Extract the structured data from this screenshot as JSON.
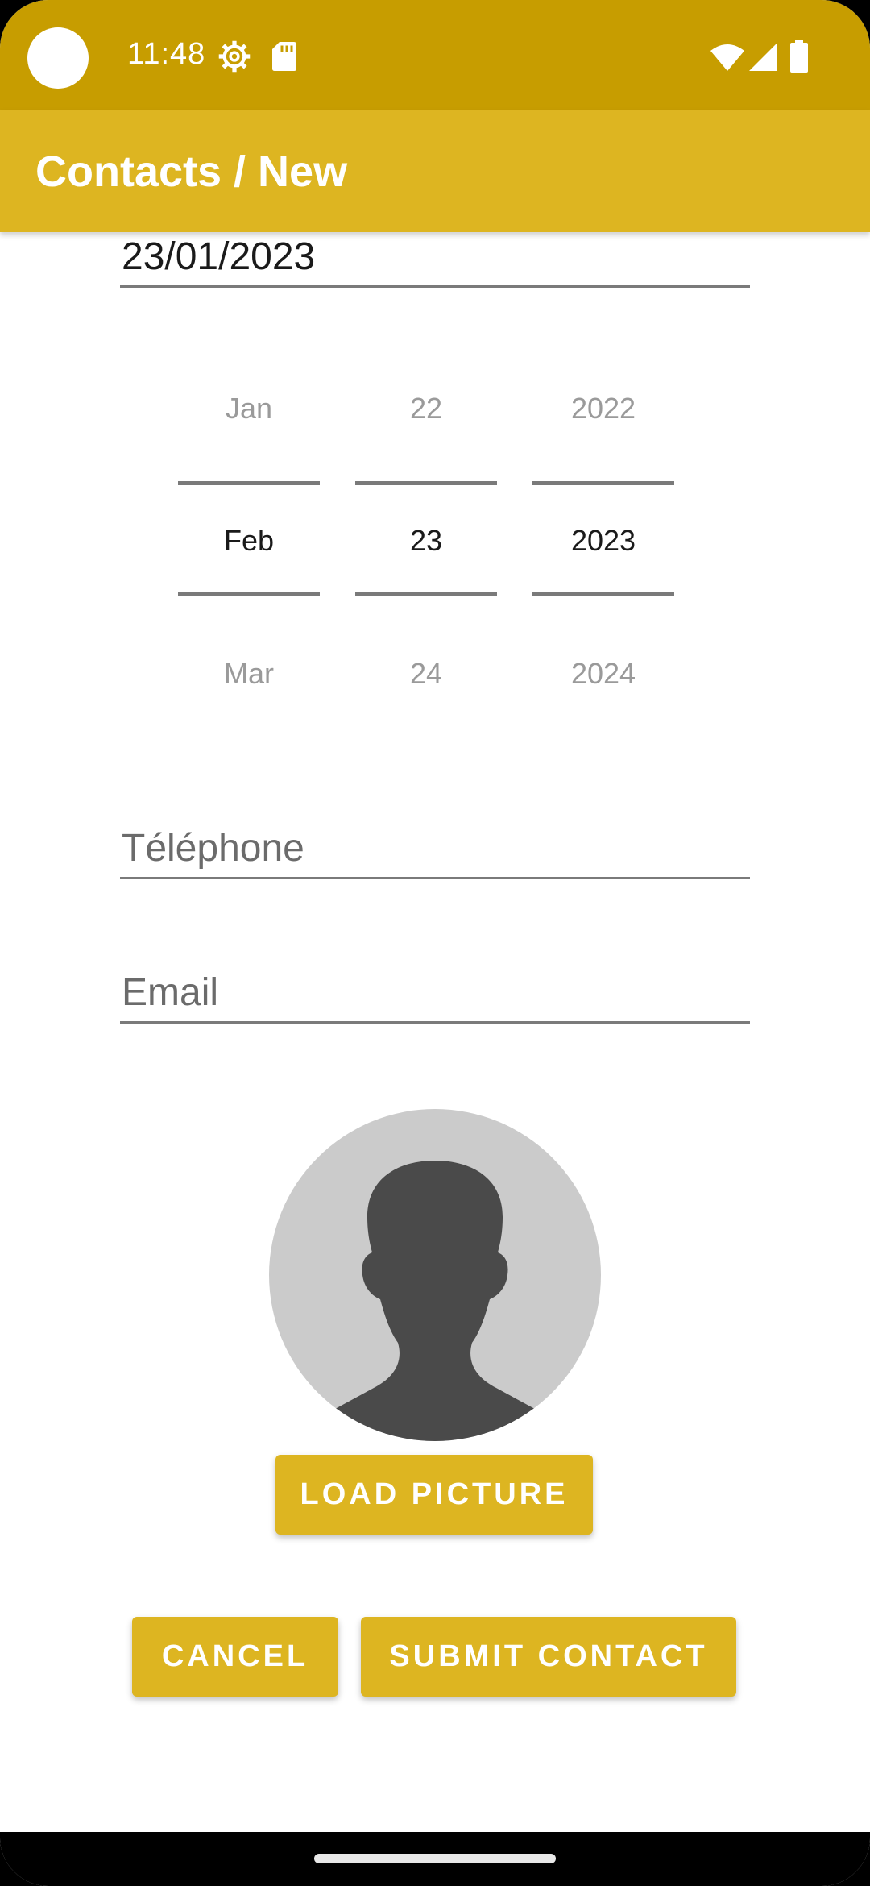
{
  "status_bar": {
    "time": "11:48",
    "icons": [
      "settings-gear-icon",
      "sd-card-icon",
      "wifi-icon",
      "cell-signal-icon",
      "battery-icon"
    ],
    "color": "#C79D00"
  },
  "app_bar": {
    "title": "Contacts / New",
    "color": "#DDB521"
  },
  "form": {
    "date_value": "23/01/2023",
    "date_picker": {
      "months": {
        "prev": "Jan",
        "selected": "Feb",
        "next": "Mar"
      },
      "days": {
        "prev": "22",
        "selected": "23",
        "next": "24"
      },
      "years": {
        "prev": "2022",
        "selected": "2023",
        "next": "2024"
      }
    },
    "telephone_placeholder": "Téléphone",
    "email_placeholder": "Email"
  },
  "avatar": {
    "icon": "person-silhouette-icon",
    "bg_color": "#CBCBCB",
    "fg_color": "#4A4A4A"
  },
  "buttons": {
    "load_picture": "LOAD PICTURE",
    "cancel": "CANCEL",
    "submit": "SUBMIT CONTACT",
    "color": "#DDB521"
  }
}
